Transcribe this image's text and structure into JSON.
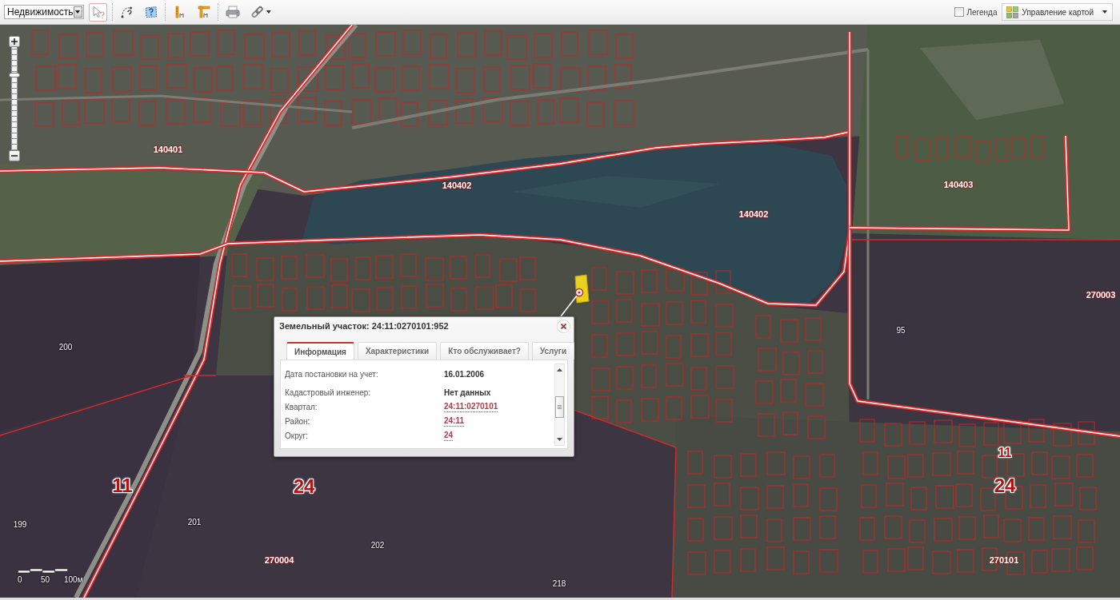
{
  "toolbar": {
    "layer_select": {
      "value": "Недвижимость"
    },
    "tools": [
      {
        "kind": "identify",
        "selected": true
      },
      {
        "kind": "path",
        "selected": false
      },
      {
        "kind": "area",
        "selected": false
      },
      {
        "kind": "ruler",
        "selected": false
      },
      {
        "kind": "area_ruler",
        "selected": false
      },
      {
        "kind": "print",
        "selected": false
      },
      {
        "kind": "link",
        "selected": false
      }
    ],
    "legend": {
      "label": "Легенда",
      "checked": false
    },
    "map_control": {
      "label": "Управление картой"
    }
  },
  "map": {
    "zoom_slider": {
      "level": 0.74
    },
    "labels": [
      {
        "kind": "quarter",
        "text": "140401"
      },
      {
        "kind": "quarter",
        "text": "140402"
      },
      {
        "kind": "quarter",
        "text": "140403"
      },
      {
        "kind": "quarter",
        "text": "140402"
      },
      {
        "kind": "quarter",
        "text": "270003"
      },
      {
        "kind": "plot",
        "text": "95"
      },
      {
        "kind": "plot",
        "text": "200"
      },
      {
        "kind": "region",
        "text": "11"
      },
      {
        "kind": "district",
        "text": "11"
      },
      {
        "kind": "district",
        "text": "24"
      },
      {
        "kind": "district",
        "text": "24"
      },
      {
        "kind": "plot",
        "text": "199"
      },
      {
        "kind": "plot",
        "text": "201"
      },
      {
        "kind": "plot",
        "text": "202"
      },
      {
        "kind": "quarter",
        "text": "270004"
      },
      {
        "kind": "quarter",
        "text": "270101"
      },
      {
        "kind": "plot",
        "text": "218"
      }
    ],
    "scale_bar": {
      "labels": [
        "0",
        "50",
        "100м"
      ]
    }
  },
  "popup": {
    "title": "Земельный участок: 24:11:0270101:952",
    "tabs": [
      {
        "label": "Информация",
        "selected": true
      },
      {
        "label": "Характеристики",
        "selected": false
      },
      {
        "label": "Кто обслуживает?",
        "selected": false
      },
      {
        "label": "Услуги",
        "selected": false
      }
    ],
    "rows": [
      {
        "kind": "text",
        "label": "Дата постановки на учет:",
        "value": "16.01.2006"
      },
      {
        "kind": "text",
        "label": "Кадастровый инженер:",
        "value": "Нет данных"
      },
      {
        "kind": "link",
        "label": "Квартал:",
        "value": "24:11:0270101"
      },
      {
        "kind": "link",
        "label": "Район:",
        "value": "24:11"
      },
      {
        "kind": "link",
        "label": "Округ:",
        "value": "24"
      }
    ]
  }
}
